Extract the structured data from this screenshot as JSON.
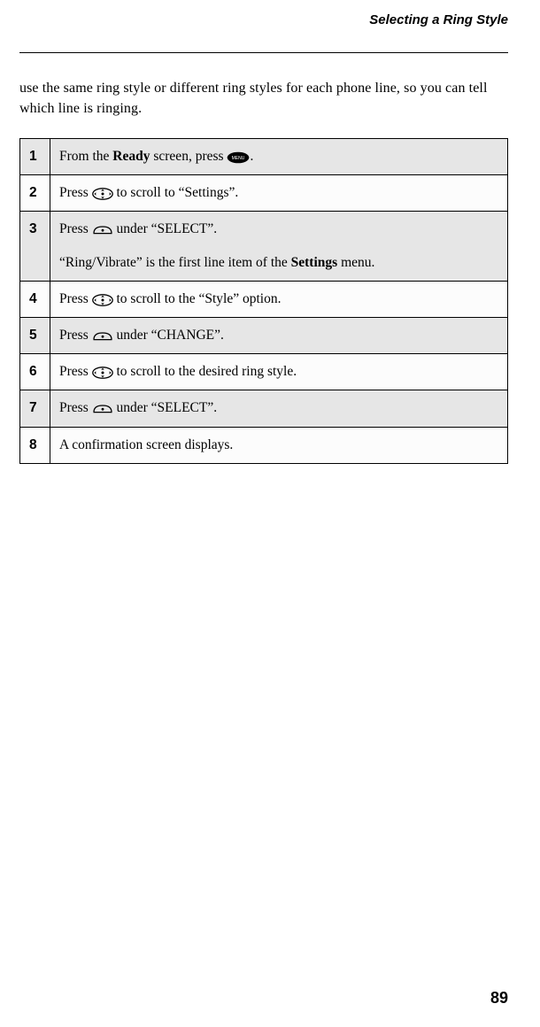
{
  "header": "Selecting a Ring Style",
  "intro": "use the same ring style or different ring styles for each phone line, so you can tell which line is ringing.",
  "steps": [
    {
      "num": "1",
      "parts": [
        {
          "t": "text",
          "v": "From the "
        },
        {
          "t": "bold",
          "v": "Ready"
        },
        {
          "t": "text",
          "v": " screen, press "
        },
        {
          "t": "icon",
          "v": "menu-key"
        },
        {
          "t": "text",
          "v": "."
        }
      ],
      "sub": null
    },
    {
      "num": "2",
      "parts": [
        {
          "t": "text",
          "v": "Press "
        },
        {
          "t": "icon",
          "v": "scroll-key"
        },
        {
          "t": "text",
          "v": " to scroll to “Settings”."
        }
      ],
      "sub": null
    },
    {
      "num": "3",
      "parts": [
        {
          "t": "text",
          "v": "Press "
        },
        {
          "t": "icon",
          "v": "soft-key"
        },
        {
          "t": "text",
          "v": " under “SELECT”."
        }
      ],
      "sub": [
        {
          "t": "text",
          "v": "“Ring/Vibrate” is the first line item of the "
        },
        {
          "t": "bold",
          "v": "Settings"
        },
        {
          "t": "text",
          "v": " menu."
        }
      ]
    },
    {
      "num": "4",
      "parts": [
        {
          "t": "text",
          "v": "Press "
        },
        {
          "t": "icon",
          "v": "scroll-key"
        },
        {
          "t": "text",
          "v": " to scroll to the “Style” option."
        }
      ],
      "sub": null
    },
    {
      "num": "5",
      "parts": [
        {
          "t": "text",
          "v": "Press "
        },
        {
          "t": "icon",
          "v": "soft-key"
        },
        {
          "t": "text",
          "v": " under “CHANGE”."
        }
      ],
      "sub": null
    },
    {
      "num": "6",
      "parts": [
        {
          "t": "text",
          "v": "Press "
        },
        {
          "t": "icon",
          "v": "scroll-key"
        },
        {
          "t": "text",
          "v": " to scroll to the desired ring style."
        }
      ],
      "sub": null
    },
    {
      "num": "7",
      "parts": [
        {
          "t": "text",
          "v": "Press "
        },
        {
          "t": "icon",
          "v": "soft-key"
        },
        {
          "t": "text",
          "v": " under “SELECT”."
        }
      ],
      "sub": null
    },
    {
      "num": "8",
      "parts": [
        {
          "t": "text",
          "v": "A confirmation screen displays."
        }
      ],
      "sub": null
    }
  ],
  "pageNumber": "89"
}
